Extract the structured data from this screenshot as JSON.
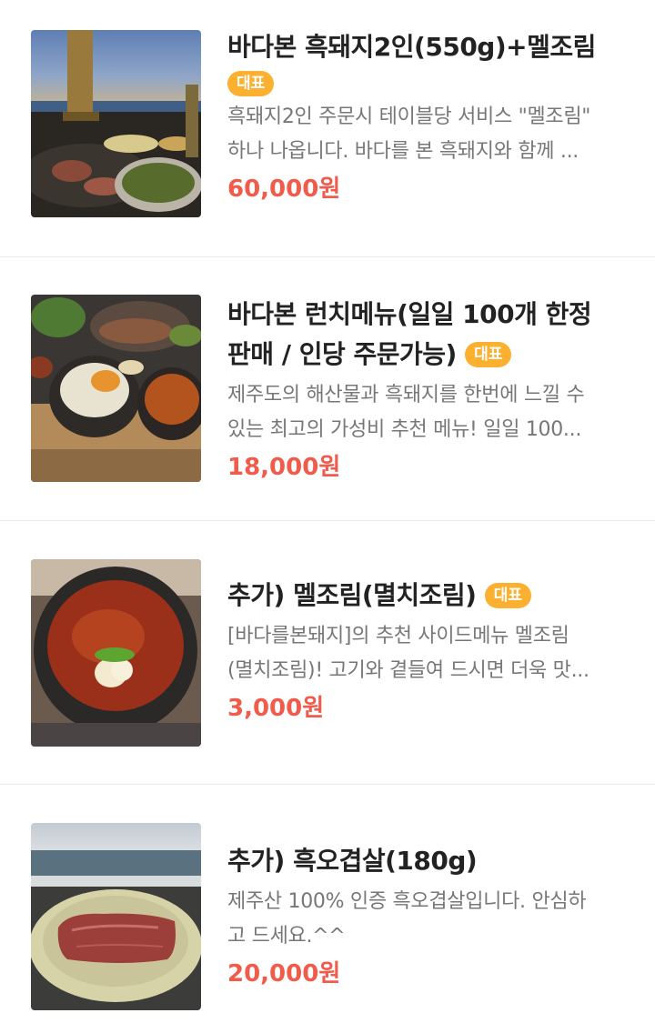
{
  "colors": {
    "badge_bg": "#fbb030",
    "price": "#f05b4b",
    "title": "#222222",
    "description": "#777777"
  },
  "menu_items": [
    {
      "title": "바다본 흑돼지2인(550g)+멜조림",
      "badge": "대표",
      "description_lines": [
        "흑돼지2인 주문시 테이블당 서비스 \"멜조림\"",
        "하나 나옵니다. 바다를 본 흑돼지와 함께 ..."
      ],
      "price": "60,000원",
      "image": "pork-bbq-on-terrace-by-sea"
    },
    {
      "title_lines": [
        "바다본 런치메뉴(일일 100개 한정",
        "판매 / 인당 주문가능)"
      ],
      "badge": "대표",
      "description_lines": [
        "제주도의 해산물과 흑돼지를 한번에 느낄 수",
        "있는 최고의 가성비 추천 메뉴! 일일 100..."
      ],
      "price": "18,000원",
      "image": "lunch-set-stone-pot-rice"
    },
    {
      "title": "추가) 멜조림(멸치조림)",
      "badge": "대표",
      "description_lines": [
        "[바다를본돼지]의 추천 사이드메뉴 멜조림",
        "(멸치조림)! 고기와 곁들여 드시면 더욱 맛..."
      ],
      "price": "3,000원",
      "image": "braised-anchovy-stew-pot"
    },
    {
      "title": "추가) 흑오겹살(180g)",
      "description_lines": [
        "제주산 100% 인증 흑오겹살입니다. 안심하",
        "고 드세요.^^"
      ],
      "price": "20,000원",
      "image": "raw-pork-belly-plate-by-sea"
    }
  ]
}
